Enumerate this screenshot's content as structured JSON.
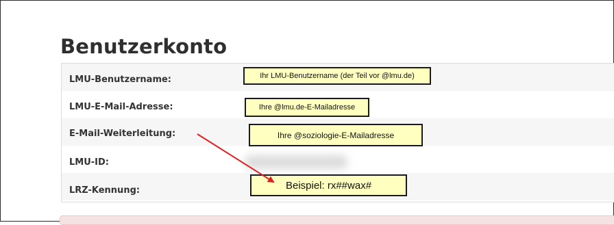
{
  "page": {
    "title": "Benutzerkonto"
  },
  "rows": [
    {
      "label": "LMU-Benutzername:"
    },
    {
      "label": "LMU-E-Mail-Adresse:"
    },
    {
      "label": "E-Mail-Weiterleitung:"
    },
    {
      "label": "LMU-ID:"
    },
    {
      "label": "LRZ-Kennung:"
    }
  ],
  "annotations": {
    "username_note": "Ihr LMU-Benutzername (der Teil vor @lmu.de)",
    "email_note": "Ihre @lmu.de-E-Mailadresse",
    "forward_note": "Ihre @soziologie-E-Mailadresse",
    "lrz_note": "Beispiel: rx##wax#",
    "note_background": "#ffffc0",
    "arrow_color": "#e02020"
  }
}
